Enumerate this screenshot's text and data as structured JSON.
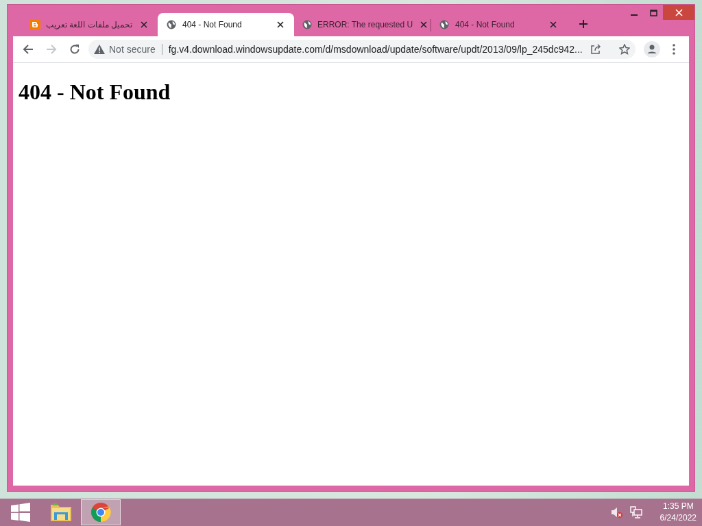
{
  "browser": {
    "tabs": [
      {
        "title": "تحميل ملفات اللغة تعريب",
        "kind": "blogger",
        "selected": false
      },
      {
        "title": "404 - Not Found",
        "kind": "globe",
        "selected": true
      },
      {
        "title": "ERROR: The requested U",
        "kind": "globe",
        "selected": false
      },
      {
        "title": "404 - Not Found",
        "kind": "globe",
        "selected": false
      }
    ],
    "toolbar": {
      "forward_enabled": false,
      "security": "Not secure",
      "url": "fg.v4.download.windowsupdate.com/d/msdownload/update/software/updt/2013/09/lp_245dc942..."
    },
    "page": {
      "heading": "404 - Not Found"
    }
  },
  "taskbar": {
    "apps": [
      {
        "kind": "explorer",
        "selected": false
      },
      {
        "kind": "chrome",
        "selected": true
      }
    ],
    "clock": {
      "time": "1:35 PM",
      "date": "6/24/2022"
    }
  }
}
